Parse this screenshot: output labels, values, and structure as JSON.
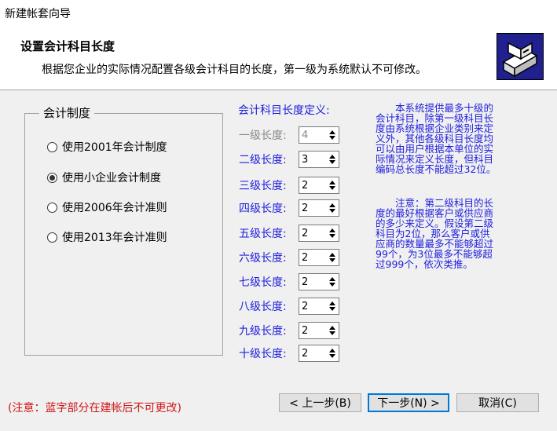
{
  "window": {
    "title": "新建帐套向导"
  },
  "header": {
    "title": "设置会计科目长度",
    "subtitle": "根据您企业的实际情况配置各级会计科目的长度，第一级为系统默认不可修改。",
    "logo_icon": "wizard-box-icon"
  },
  "system_group": {
    "title": "会计制度",
    "options": [
      {
        "label": "使用2001年会计制度",
        "selected": false
      },
      {
        "label": "使用小企业会计制度",
        "selected": true
      },
      {
        "label": "使用2006年会计准则",
        "selected": false
      },
      {
        "label": "使用2013年会计准则",
        "selected": false
      }
    ]
  },
  "length_def": {
    "title": "会计科目长度定义:",
    "levels": [
      {
        "label": "一级长度:",
        "value": "4",
        "disabled": true
      },
      {
        "label": "二级长度:",
        "value": "3",
        "disabled": false
      },
      {
        "label": "三级长度:",
        "value": "2",
        "disabled": false
      },
      {
        "label": "四级长度:",
        "value": "2",
        "disabled": false
      },
      {
        "label": "五级长度:",
        "value": "2",
        "disabled": false
      },
      {
        "label": "六级长度:",
        "value": "2",
        "disabled": false
      },
      {
        "label": "七级长度:",
        "value": "2",
        "disabled": false
      },
      {
        "label": "八级长度:",
        "value": "2",
        "disabled": false
      },
      {
        "label": "九级长度:",
        "value": "2",
        "disabled": false
      },
      {
        "label": "十级长度:",
        "value": "2",
        "disabled": false
      }
    ]
  },
  "info": {
    "para1": [
      "　　本系统提供最多十级的",
      "会计科目，除第一级科目长",
      "度由系统根据企业类别来定",
      "义外，其他各级科目长度均",
      "可以由用户根据本单位的实",
      "际情况来定义长度，但科目",
      "编码总长度不能超过32位。"
    ],
    "para2": [
      "　　注意：第二级科目的长",
      "度的最好根据客户或供应商",
      "的多少来定义。假设第二级",
      "科目为2位，那么客户或供",
      "应商的数量最多不能够超过",
      "99个，为3位最多不能够超",
      "过999个，依次类推。"
    ]
  },
  "footer": {
    "note": "(注意：蓝字部分在建帐后不可更改)",
    "prev_label": "< 上一步(B)",
    "next_label": "下一步(N) >",
    "cancel_label": "取消(C)"
  },
  "colors": {
    "accent_blue": "#1d1ddd",
    "note_red": "#d01515",
    "focus_border": "#0078d7"
  }
}
